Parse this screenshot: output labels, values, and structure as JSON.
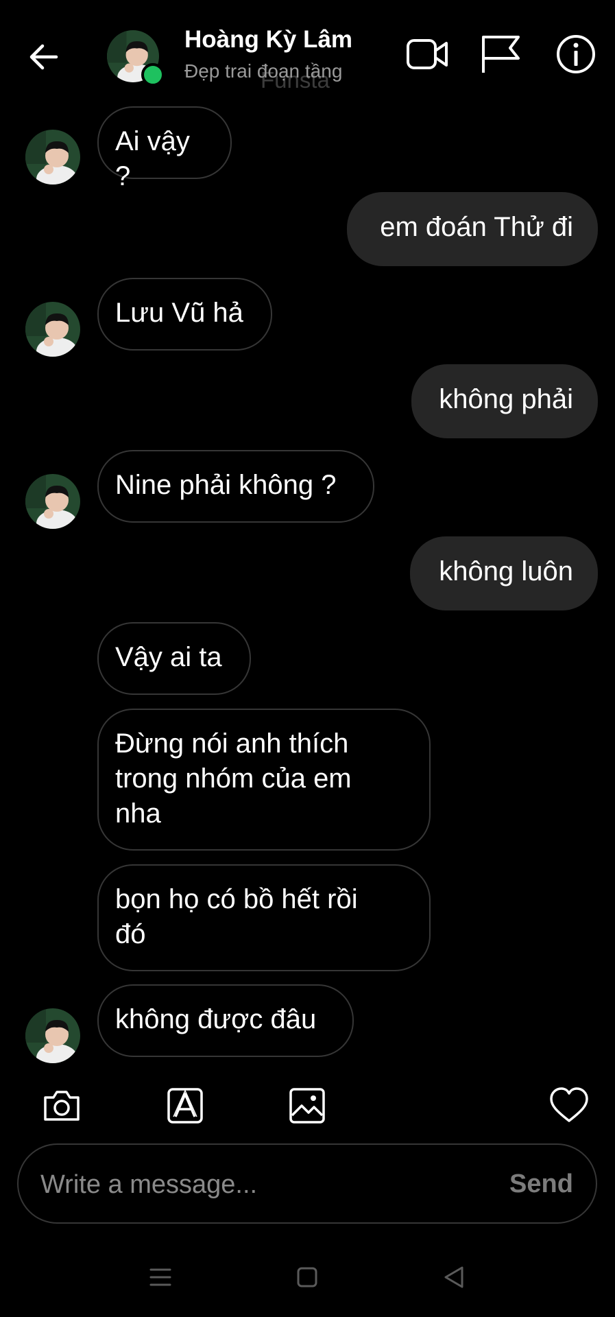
{
  "header": {
    "name": "Hoàng Kỳ Lâm",
    "subtitle": "Đẹp trai đoạn tầng",
    "ghost_text": "Funsta"
  },
  "messages": [
    {
      "from": "them",
      "text": "Ai vậy ?"
    },
    {
      "from": "me",
      "text": "em đoán Thử đi"
    },
    {
      "from": "them",
      "text": "Lưu Vũ hả"
    },
    {
      "from": "me",
      "text": "không phải"
    },
    {
      "from": "them",
      "text": "Nine phải không ?"
    },
    {
      "from": "me",
      "text": "không luôn"
    },
    {
      "from": "them",
      "text": "Vậy ai ta"
    },
    {
      "from": "them",
      "lines": [
        "Đừng nói anh thích",
        "trong nhóm của em",
        "nha"
      ]
    },
    {
      "from": "them",
      "lines": [
        "bọn họ có bồ hết rồi",
        "đó"
      ]
    },
    {
      "from": "them",
      "text": "không được đâu"
    }
  ],
  "composer": {
    "placeholder": "Write a message...",
    "send_label": "Send"
  },
  "icons": {
    "header": [
      "back-arrow-icon",
      "video-call-icon",
      "flag-icon",
      "info-icon"
    ],
    "toolbar": [
      "camera-icon",
      "sticker-icon",
      "gallery-icon",
      "heart-icon"
    ],
    "nav": [
      "menu-icon",
      "home-icon",
      "back-icon"
    ]
  },
  "colors": {
    "background": "#000000",
    "outgoing_bubble": "#262626",
    "incoming_border": "#363636",
    "online_dot": "#1ec15f"
  }
}
